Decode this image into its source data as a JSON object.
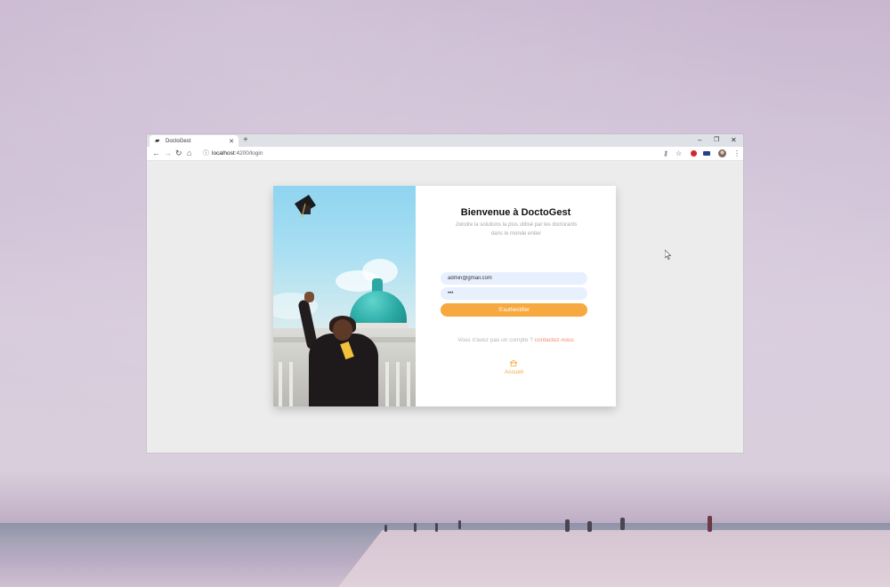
{
  "browser": {
    "tab_title": "DoctoGest",
    "address_host": "localhost",
    "address_path": ":4200/login",
    "icons": {
      "tab_favicon": "graduation-cap-icon",
      "tab_close": "close-icon",
      "new_tab": "plus-icon",
      "minimize": "minimize-icon",
      "restore": "restore-icon",
      "close_window": "close-icon",
      "back": "arrow-left-icon",
      "forward": "arrow-right-icon",
      "reload": "reload-icon",
      "home": "home-icon",
      "site_info": "info-icon",
      "key": "key-icon",
      "bookmark": "star-icon",
      "menu": "kebab-icon"
    }
  },
  "login": {
    "title": "Bienvenue à DoctoGest",
    "subtitle": "Joindre la solutions la plus utilisé par les doctorants dans le monde entier",
    "email_value": "admin@gmail.com",
    "password_value": "•••",
    "submit_label": "S'authentifier",
    "no_account_text": "Vous n'avez pas un compte ?",
    "contact_link": "contactez-nous",
    "home_link": "Accueil",
    "home_icon": "house-icon"
  },
  "colors": {
    "accent": "#f7a83f",
    "link": "#f58b6f",
    "input_bg": "#e8f0fe",
    "dome": "#2aa9a5"
  }
}
